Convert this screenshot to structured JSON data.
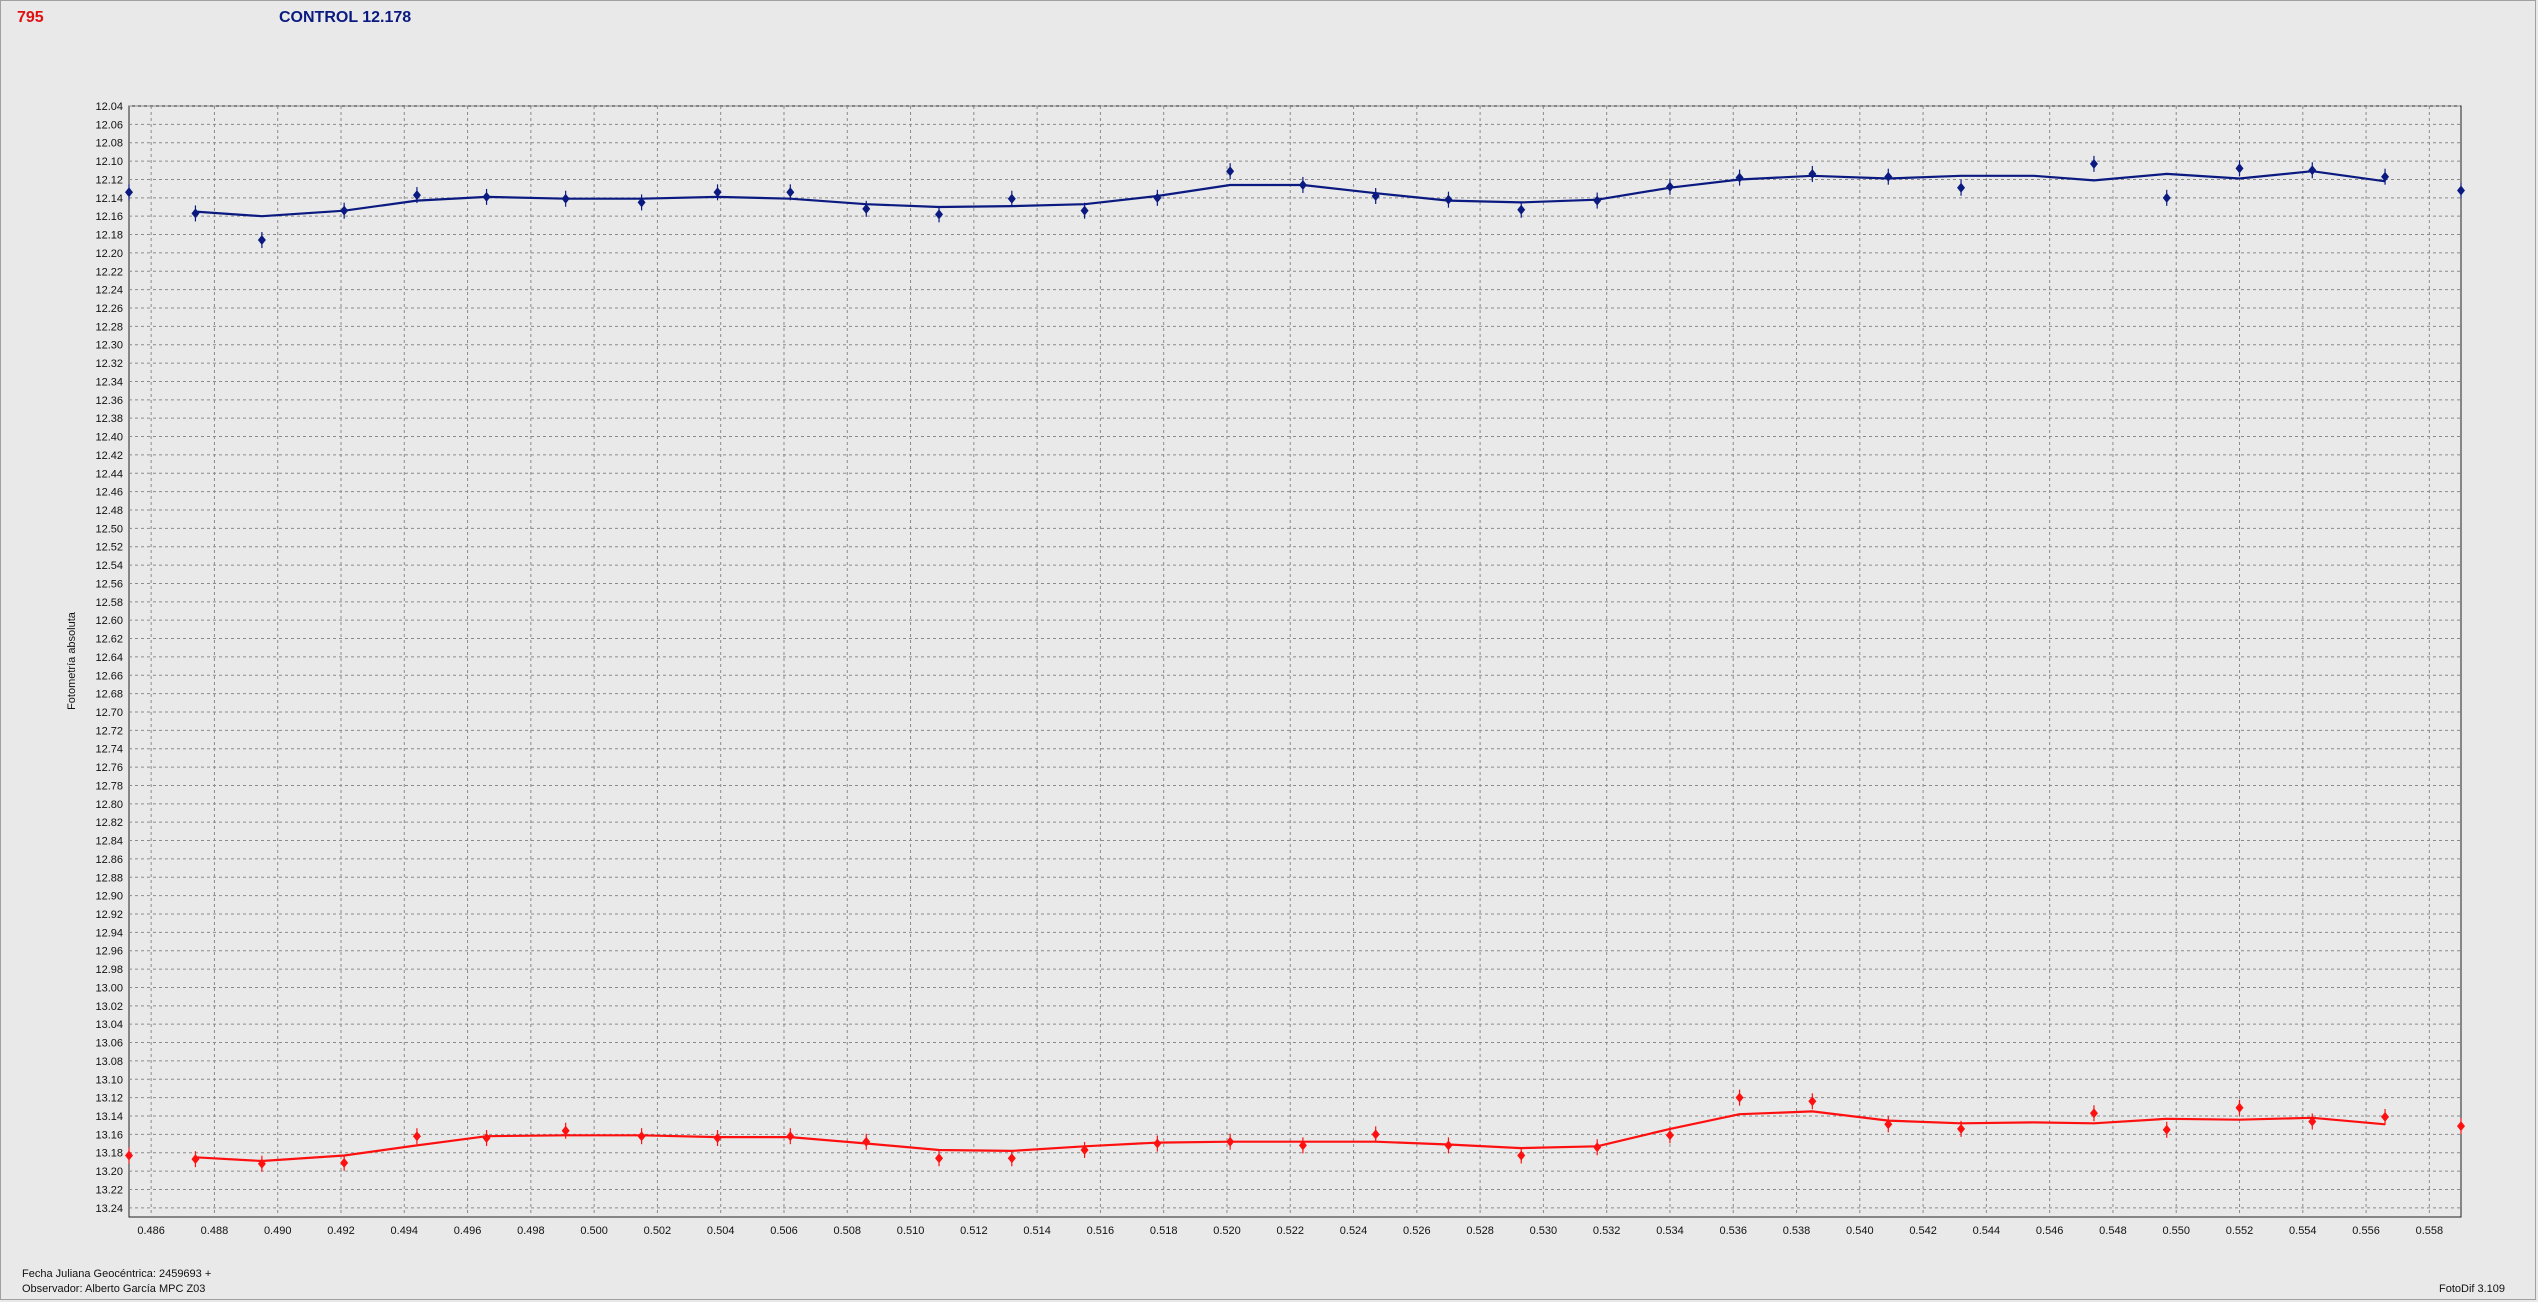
{
  "header": {
    "object_id": "795",
    "control_label": "CONTROL 12.178"
  },
  "footer": {
    "jd_label": "Fecha Juliana Geocéntrica: 2459693 +",
    "observer_label": "Observador: Alberto García MPC Z03",
    "version": "FotoDif 3.109"
  },
  "colors": {
    "series_blue": "#0b1a80",
    "series_red": "#ff1010",
    "grid": "#8a8a8a",
    "plot_bg": "#e9e9e9"
  },
  "chart_data": {
    "type": "line",
    "title": "",
    "xlabel": "",
    "ylabel": "Fotometría absoluta",
    "xlim": [
      0.4853,
      0.559
    ],
    "ylim": [
      13.25,
      12.04
    ],
    "y_inverted": true,
    "grid": true,
    "x_ticks": [
      0.486,
      0.488,
      0.49,
      0.492,
      0.494,
      0.496,
      0.498,
      0.5,
      0.502,
      0.504,
      0.506,
      0.508,
      0.51,
      0.512,
      0.514,
      0.516,
      0.518,
      0.52,
      0.522,
      0.524,
      0.526,
      0.528,
      0.53,
      0.532,
      0.534,
      0.536,
      0.538,
      0.54,
      0.542,
      0.544,
      0.546,
      0.548,
      0.55,
      0.552,
      0.554,
      0.556,
      0.558
    ],
    "x_tick_labels": [
      "0.486",
      "0.488",
      "0.490",
      "0.492",
      "0.494",
      "0.496",
      "0.498",
      "0.500",
      "0.502",
      "0.504",
      "0.506",
      "0.508",
      "0.510",
      "0.512",
      "0.514",
      "0.516",
      "0.518",
      "0.520",
      "0.522",
      "0.524",
      "0.526",
      "0.528",
      "0.530",
      "0.532",
      "0.534",
      "0.536",
      "0.538",
      "0.540",
      "0.542",
      "0.544",
      "0.546",
      "0.548",
      "0.550",
      "0.552",
      "0.554",
      "0.556",
      "0.558"
    ],
    "y_ticks": [
      12.04,
      12.06,
      12.08,
      12.1,
      12.12,
      12.14,
      12.16,
      12.18,
      12.2,
      12.22,
      12.24,
      12.26,
      12.28,
      12.3,
      12.32,
      12.34,
      12.36,
      12.38,
      12.4,
      12.42,
      12.44,
      12.46,
      12.48,
      12.5,
      12.52,
      12.54,
      12.56,
      12.58,
      12.6,
      12.62,
      12.64,
      12.66,
      12.68,
      12.7,
      12.72,
      12.74,
      12.76,
      12.78,
      12.8,
      12.82,
      12.84,
      12.86,
      12.88,
      12.9,
      12.92,
      12.94,
      12.96,
      12.98,
      13.0,
      13.02,
      13.04,
      13.06,
      13.08,
      13.1,
      13.12,
      13.14,
      13.16,
      13.18,
      13.2,
      13.22,
      13.24
    ],
    "y_tick_labels": [
      "12.04",
      "12.06",
      "12.08",
      "12.10",
      "12.12",
      "12.14",
      "12.16",
      "12.18",
      "12.20",
      "12.22",
      "12.24",
      "12.26",
      "12.28",
      "12.30",
      "12.32",
      "12.34",
      "12.36",
      "12.38",
      "12.40",
      "12.42",
      "12.44",
      "12.46",
      "12.48",
      "12.50",
      "12.52",
      "12.54",
      "12.56",
      "12.58",
      "12.60",
      "12.62",
      "12.64",
      "12.66",
      "12.68",
      "12.70",
      "12.72",
      "12.74",
      "12.76",
      "12.78",
      "12.80",
      "12.82",
      "12.84",
      "12.86",
      "12.88",
      "12.90",
      "12.92",
      "12.94",
      "12.96",
      "12.98",
      "13.00",
      "13.02",
      "13.04",
      "13.06",
      "13.08",
      "13.10",
      "13.12",
      "13.14",
      "13.16",
      "13.18",
      "13.20",
      "13.22",
      "13.24"
    ],
    "series": [
      {
        "color": "#0b1a80",
        "points": {
          "x": [
            0.4853,
            0.4874,
            0.4895,
            0.4921,
            0.4944,
            0.4966,
            0.4991,
            0.5015,
            0.5039,
            0.5062,
            0.5086,
            0.5109,
            0.5132,
            0.5155,
            0.5178,
            0.5201,
            0.5224,
            0.5247,
            0.527,
            0.5293,
            0.5317,
            0.534,
            0.5362,
            0.5385,
            0.5409,
            0.5432,
            0.5474,
            0.5497,
            0.552,
            0.5543,
            0.5566,
            0.559
          ],
          "y": [
            12.134,
            12.157,
            12.186,
            12.154,
            12.137,
            12.139,
            12.141,
            12.145,
            12.134,
            12.134,
            12.152,
            12.158,
            12.141,
            12.154,
            12.14,
            12.111,
            12.126,
            12.138,
            12.142,
            12.153,
            12.143,
            12.128,
            12.118,
            12.114,
            12.117,
            12.129,
            12.103,
            12.14,
            12.108,
            12.11,
            12.117,
            12.132
          ]
        },
        "fit": {
          "x": [
            0.4874,
            0.4895,
            0.4921,
            0.4944,
            0.4966,
            0.4991,
            0.5015,
            0.5039,
            0.5062,
            0.5086,
            0.5109,
            0.5132,
            0.5155,
            0.5178,
            0.5201,
            0.5224,
            0.5247,
            0.527,
            0.5293,
            0.5317,
            0.534,
            0.5362,
            0.5385,
            0.5409,
            0.5432,
            0.5455,
            0.5474,
            0.5497,
            0.552,
            0.5543,
            0.5566
          ],
          "y": [
            12.155,
            12.16,
            12.154,
            12.143,
            12.139,
            12.141,
            12.141,
            12.139,
            12.141,
            12.147,
            12.15,
            12.149,
            12.147,
            12.138,
            12.126,
            12.126,
            12.135,
            12.143,
            12.145,
            12.142,
            12.129,
            12.12,
            12.116,
            12.119,
            12.116,
            12.116,
            12.121,
            12.114,
            12.119,
            12.111,
            12.122
          ]
        }
      },
      {
        "color": "#ff1010",
        "points": {
          "x": [
            0.4853,
            0.4874,
            0.4895,
            0.4921,
            0.4944,
            0.4966,
            0.4991,
            0.5015,
            0.5039,
            0.5062,
            0.5086,
            0.5109,
            0.5132,
            0.5155,
            0.5178,
            0.5201,
            0.5224,
            0.5247,
            0.527,
            0.5293,
            0.5317,
            0.534,
            0.5362,
            0.5385,
            0.5409,
            0.5432,
            0.5474,
            0.5497,
            0.552,
            0.5543,
            0.5566,
            0.559
          ],
          "y": [
            13.183,
            13.187,
            13.192,
            13.191,
            13.162,
            13.164,
            13.156,
            13.162,
            13.164,
            13.162,
            13.168,
            13.186,
            13.186,
            13.177,
            13.17,
            13.168,
            13.172,
            13.16,
            13.172,
            13.183,
            13.174,
            13.161,
            13.12,
            13.124,
            13.149,
            13.154,
            13.137,
            13.155,
            13.131,
            13.146,
            13.141,
            13.151
          ]
        },
        "fit": {
          "x": [
            0.4874,
            0.4895,
            0.4921,
            0.4944,
            0.4966,
            0.4991,
            0.5015,
            0.5039,
            0.5062,
            0.5086,
            0.5109,
            0.5132,
            0.5155,
            0.5178,
            0.5201,
            0.5224,
            0.5247,
            0.527,
            0.5293,
            0.5317,
            0.534,
            0.5362,
            0.5385,
            0.5409,
            0.5432,
            0.5455,
            0.5474,
            0.5497,
            0.552,
            0.5543,
            0.5566
          ],
          "y": [
            13.185,
            13.189,
            13.183,
            13.172,
            13.162,
            13.161,
            13.161,
            13.163,
            13.163,
            13.17,
            13.177,
            13.178,
            13.173,
            13.169,
            13.168,
            13.168,
            13.168,
            13.171,
            13.175,
            13.173,
            13.154,
            13.138,
            13.135,
            13.145,
            13.148,
            13.147,
            13.148,
            13.143,
            13.144,
            13.142,
            13.149
          ]
        }
      }
    ]
  }
}
